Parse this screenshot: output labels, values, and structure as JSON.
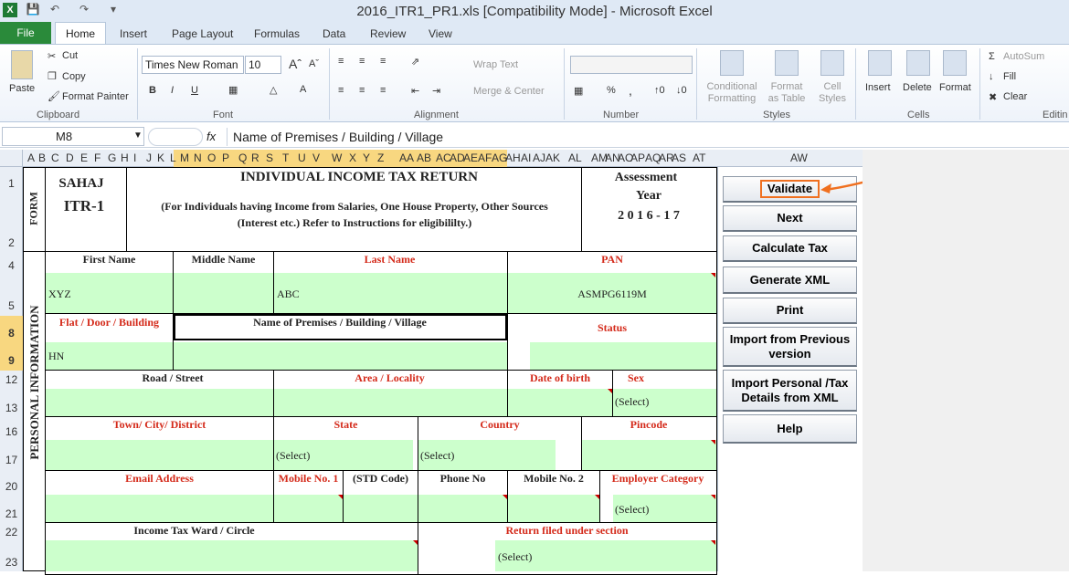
{
  "window": {
    "title": "2016_ITR1_PR1.xls  [Compatibility Mode]  -  Microsoft Excel"
  },
  "ribbon_tabs": [
    "File",
    "Home",
    "Insert",
    "Page Layout",
    "Formulas",
    "Data",
    "Review",
    "View"
  ],
  "ribbon": {
    "clipboard": {
      "paste": "Paste",
      "cut": "Cut",
      "copy": "Copy",
      "format_painter": "Format Painter",
      "label": "Clipboard"
    },
    "font": {
      "name": "Times New Roman",
      "size": "10",
      "bold": "B",
      "italic": "I",
      "underline": "U",
      "label": "Font"
    },
    "alignment": {
      "wrap": "Wrap Text",
      "merge": "Merge & Center",
      "label": "Alignment"
    },
    "number": {
      "percent": "%",
      "comma": ",",
      "label": "Number"
    },
    "styles": {
      "conditional": "Conditional Formatting",
      "format_table": "Format as Table",
      "cell_styles": "Cell Styles",
      "label": "Styles"
    },
    "cells": {
      "insert": "Insert",
      "delete": "Delete",
      "format": "Format",
      "label": "Cells"
    },
    "editing": {
      "autosum": "AutoSum",
      "fill": "Fill",
      "clear": "Clear",
      "label": "Editin"
    }
  },
  "formula_bar": {
    "name_box": "M8",
    "fx": "fx",
    "content": "Name of Premises / Building / Village"
  },
  "columns": [
    "A",
    "B",
    "C",
    "D",
    "E",
    "F",
    "G",
    "H",
    "I",
    "J",
    "K",
    "L",
    "M",
    "N",
    "O",
    "P",
    "Q",
    "R",
    "S",
    "T",
    "U",
    "V",
    "W",
    "X",
    "Y",
    "Z",
    "AA",
    "AB",
    "AC",
    "AD",
    "AE",
    "AF",
    "AG",
    "AH",
    "AI",
    "AJ",
    "AK",
    "AL",
    "AM",
    "AN",
    "AO",
    "AP",
    "AQ",
    "AR",
    "AS",
    "AT",
    "AW"
  ],
  "rows": [
    "1",
    "2",
    "4",
    "5",
    "8",
    "9",
    "12",
    "13",
    "16",
    "17",
    "20",
    "21",
    "22",
    "23"
  ],
  "form": {
    "form_label": "FORM",
    "sahaj": "SAHAJ",
    "itr": "ITR-1",
    "heading": "INDIVIDUAL INCOME TAX RETURN",
    "sub1": "(For Individuals having Income from Salaries, One House Property, Other Sources",
    "sub2": "(Interest  etc.) Refer to Instructions for eligibililty.)",
    "ay1": "Assessment",
    "ay2": "Year",
    "ay3": "2 0 1 6 - 1 7",
    "section": "PERSONAL INFORMATION",
    "first_name": "First Name",
    "middle_name": "Middle Name",
    "last_name": "Last Name",
    "pan": "PAN",
    "first_value": "XYZ",
    "last_value": "ABC",
    "pan_value": "ASMPG6119M",
    "flat": "Flat / Door / Building",
    "premises": "Name of Premises / Building / Village",
    "status": "Status",
    "flat_value": "HN",
    "road": "Road / Street",
    "area": "Area / Locality",
    "dob": "Date of birth",
    "sex": "Sex",
    "sex_value": "(Select)",
    "town": "Town/ City/ District",
    "state": "State",
    "country": "Country",
    "pincode": "Pincode",
    "state_value": "(Select)",
    "country_value": "(Select)",
    "email": "Email Address",
    "mobile1": "Mobile No. 1",
    "std": "(STD Code)",
    "phone": "Phone No",
    "mobile2": "Mobile No. 2",
    "employer": "Employer Category",
    "employer_value": "(Select)",
    "ward": "Income Tax Ward / Circle",
    "return_section": "Return filed under section",
    "return_value": "(Select)"
  },
  "buttons": [
    "Validate",
    "Next",
    "Calculate Tax",
    "Generate XML",
    "Print",
    "Import from Previous version",
    "Import Personal /Tax Details from XML",
    "Help"
  ],
  "colors": {
    "green_fill": "#ccffcc",
    "red_label": "#d42a1a",
    "annotation": "#f07020",
    "file_tab": "#2a8a3a"
  }
}
